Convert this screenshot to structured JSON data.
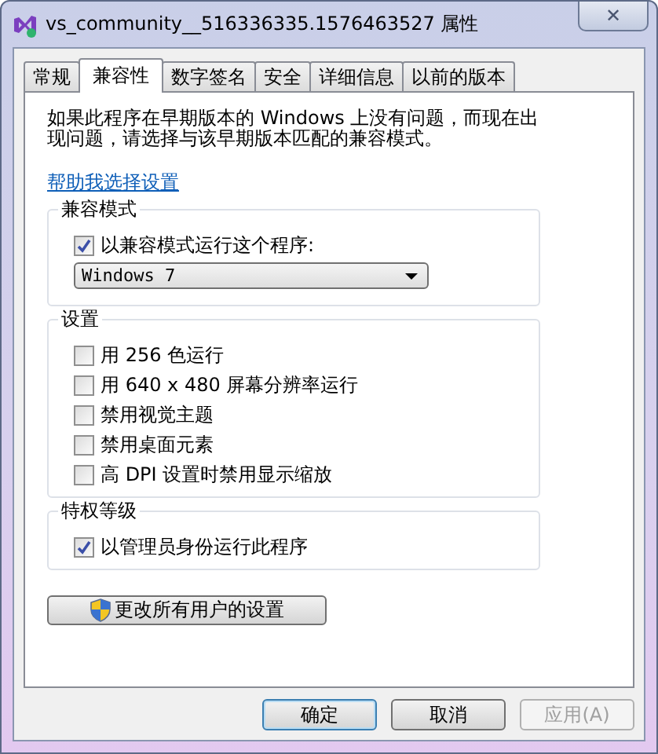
{
  "window": {
    "title": "vs_community__516336335.1576463527 属性",
    "close": "✕"
  },
  "tabs": [
    {
      "label": "常规",
      "selected": false
    },
    {
      "label": "兼容性",
      "selected": true
    },
    {
      "label": "数字签名",
      "selected": false
    },
    {
      "label": "安全",
      "selected": false
    },
    {
      "label": "详细信息",
      "selected": false
    },
    {
      "label": "以前的版本",
      "selected": false
    }
  ],
  "intro": "如果此程序在早期版本的 Windows 上没有问题，而现在出现问题，请选择与该早期版本匹配的兼容模式。",
  "help_link": "帮助我选择设置",
  "groups": [
    {
      "title": "兼容模式",
      "items": [
        {
          "kind": "checkbox",
          "label": "以兼容模式运行这个程序:",
          "checked": true
        },
        {
          "kind": "dropdown",
          "value": "Windows 7",
          "disabled": false
        }
      ]
    },
    {
      "title": "设置",
      "items": [
        {
          "kind": "checkbox",
          "label": "用 256 色运行",
          "checked": false
        },
        {
          "kind": "checkbox",
          "label": "用 640 x 480 屏幕分辨率运行",
          "checked": false
        },
        {
          "kind": "checkbox",
          "label": "禁用视觉主题",
          "checked": false
        },
        {
          "kind": "checkbox",
          "label": "禁用桌面元素",
          "checked": false
        },
        {
          "kind": "checkbox",
          "label": "高 DPI 设置时禁用显示缩放",
          "checked": false
        }
      ]
    },
    {
      "title": "特权等级",
      "items": [
        {
          "kind": "checkbox",
          "label": "以管理员身份运行此程序",
          "checked": true
        }
      ]
    }
  ],
  "all_users_button": "更改所有用户的设置",
  "buttons": [
    {
      "label": "确定",
      "disabled": false,
      "default": true
    },
    {
      "label": "取消",
      "disabled": false,
      "default": false
    },
    {
      "label": "应用(A)",
      "disabled": true,
      "default": false
    }
  ]
}
